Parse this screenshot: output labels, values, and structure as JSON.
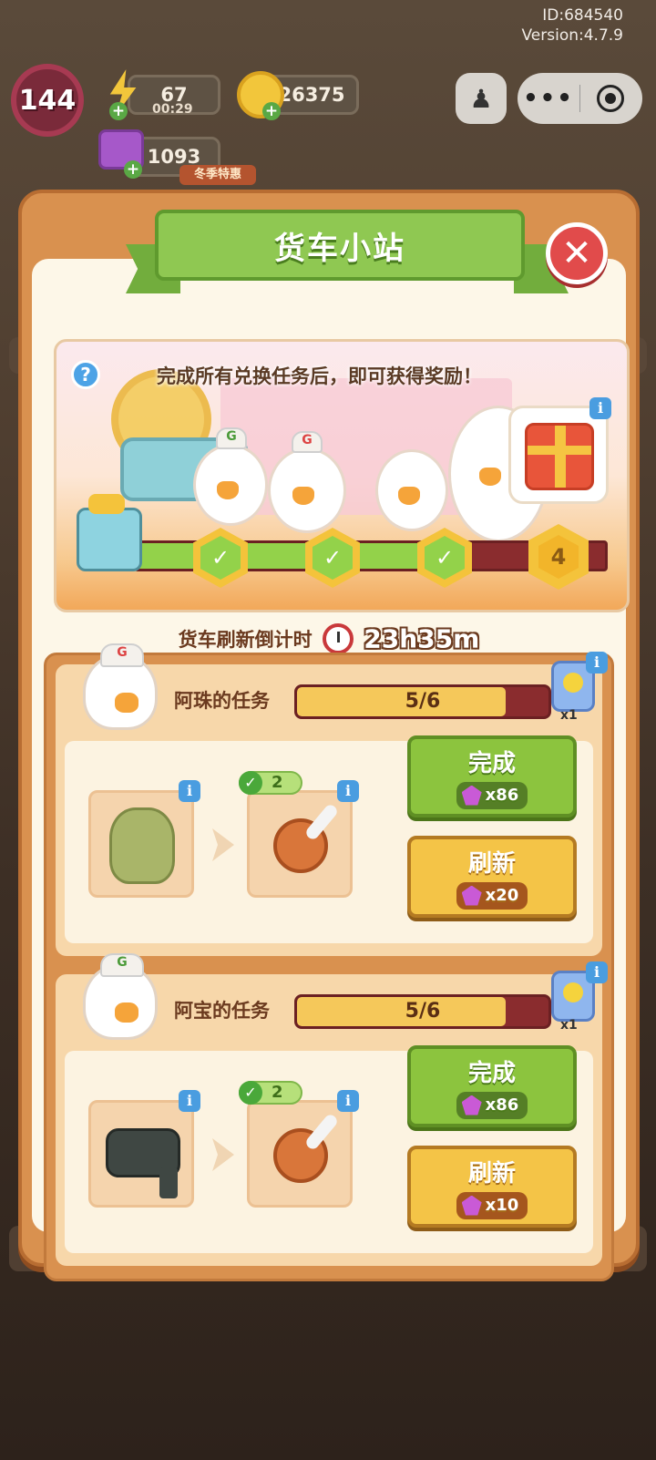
{
  "build": {
    "id": "ID:684540",
    "version": "Version:4.7.9"
  },
  "hud": {
    "level": "144",
    "energy": "67",
    "energy_timer": "00:29",
    "coins": "26375",
    "gems": "1093",
    "winter_tag": "冬季特惠"
  },
  "dialog": {
    "title": "货车小站",
    "close_label": "✕",
    "banner_text": "完成所有兑换任务后，即可获得奖励！",
    "info_label": "i",
    "help_label": "?",
    "progress": {
      "completed": 3,
      "total": 4,
      "final_label": "4"
    },
    "countdown_label": "货车刷新倒计时",
    "countdown_time": "23h35m"
  },
  "tasks": [
    {
      "title": "阿珠的任务",
      "progress_text": "5/6",
      "progress_fraction": 0.83,
      "reward_qty": "x1",
      "owned_count": "2",
      "complete_label": "完成",
      "complete_cost": "x86",
      "refresh_label": "刷新",
      "refresh_cost": "x20"
    },
    {
      "title": "阿宝的任务",
      "progress_text": "5/6",
      "progress_fraction": 0.83,
      "reward_qty": "x1",
      "owned_count": "2",
      "complete_label": "完成",
      "complete_cost": "x86",
      "refresh_label": "刷新",
      "refresh_cost": "x10"
    }
  ],
  "colors": {
    "accent_green": "#8cc43e",
    "accent_yellow": "#f4c447",
    "close_red": "#e14b4b"
  }
}
